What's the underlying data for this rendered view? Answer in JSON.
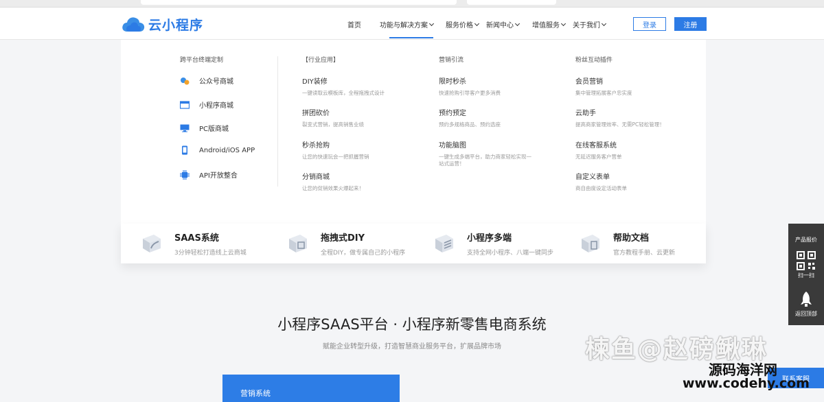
{
  "brand": {
    "name": "云小程序",
    "accent": "#2c7be5"
  },
  "nav": {
    "items": [
      {
        "label": "首页",
        "dropdown": false
      },
      {
        "label": "功能与解决方案",
        "dropdown": true
      },
      {
        "label": "服务价格",
        "dropdown": true
      },
      {
        "label": "新闻中心",
        "dropdown": true
      },
      {
        "label": "增值服务",
        "dropdown": true
      },
      {
        "label": "关于我们",
        "dropdown": true
      }
    ],
    "login": "登录",
    "register": "注册"
  },
  "mega": {
    "platform": {
      "heading": "跨平台终端定制",
      "items": [
        {
          "label": "公众号商城",
          "icon": "wechat-icon"
        },
        {
          "label": "小程序商城",
          "icon": "window-icon"
        },
        {
          "label": "PC版商城",
          "icon": "monitor-icon"
        },
        {
          "label": "Android/iOS APP",
          "icon": "phone-icon"
        },
        {
          "label": "API开放整合",
          "icon": "chip-icon"
        }
      ]
    },
    "columns": [
      {
        "heading": "【行业应用】",
        "items": [
          {
            "title": "DIY装修",
            "desc": "一键读取云模板库，全程拖拽式设计"
          },
          {
            "title": "拼团砍价",
            "desc": "裂变式营销，提高销售业绩"
          },
          {
            "title": "秒杀抢购",
            "desc": "让您的快速玩会一把抓握营销"
          },
          {
            "title": "分销商城",
            "desc": "让您的促销效果火爆起来！"
          }
        ]
      },
      {
        "heading": "营销引流",
        "items": [
          {
            "title": "限时秒杀",
            "desc": "快速抢购引导客户更多消费"
          },
          {
            "title": "预约预定",
            "desc": "预约多规格商品、预约选座"
          },
          {
            "title": "功能脑图",
            "desc": "一键生成多端平台，助力商家轻松实现一站式运营！"
          }
        ]
      },
      {
        "heading": "粉丝互动插件",
        "items": [
          {
            "title": "会员营销",
            "desc": "集中管理拓展客户忠实度"
          },
          {
            "title": "云助手",
            "desc": "提高商家管理效率、无需PC轻松管理！"
          },
          {
            "title": "在线客服系统",
            "desc": "无延迟服务客户营单"
          },
          {
            "title": "自定义表单",
            "desc": "商自由度设定活动表单"
          }
        ]
      }
    ]
  },
  "products": [
    {
      "title": "SAAS系统",
      "desc": "3分钟轻松打造线上云商城"
    },
    {
      "title": "拖拽式DIY",
      "desc": "全程DIY，做专属自己的小程序"
    },
    {
      "title": "小程序多端",
      "desc": "支持全网小程序、八端一键同步"
    },
    {
      "title": "帮助文档",
      "desc": "官方教程手册、云更新"
    }
  ],
  "hero": {
    "title": "小程序SAAS平台 · 小程序新零售电商系统",
    "subtitle": "赋能企业转型升级，打造智慧商业服务平台，扩展品牌市场"
  },
  "section": {
    "tab": "营销系统"
  },
  "sidebar": {
    "items": [
      "产品报价",
      "扫一扫",
      "返回顶部"
    ]
  },
  "consult": "联系客服",
  "watermark": {
    "text1": "楝鱼@赵磅鳅琳",
    "text2": "源码海洋网",
    "text3": "www.codehy.com"
  }
}
